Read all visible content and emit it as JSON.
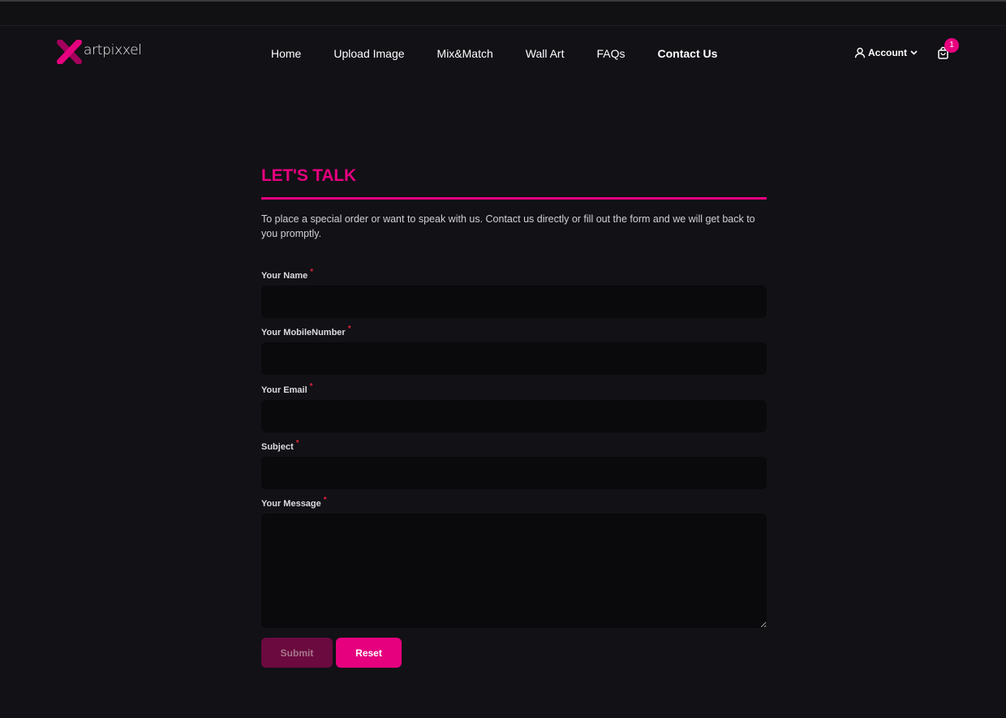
{
  "brand": {
    "name": "artpixxel",
    "accent": "#e6007e"
  },
  "nav": {
    "items": [
      {
        "label": "Home"
      },
      {
        "label": "Upload Image"
      },
      {
        "label": "Mix&Match"
      },
      {
        "label": "Wall Art"
      },
      {
        "label": "FAQs"
      },
      {
        "label": "Contact Us",
        "active": true
      }
    ]
  },
  "header": {
    "account_label": "Account",
    "account_icon": "user-icon",
    "cart_icon": "shopping-bag-icon",
    "cart_count": "1"
  },
  "contact": {
    "title": "LET'S TALK",
    "intro": "To place a special order or want to speak with us. Contact us directly or fill out the form and we will get back to you promptly.",
    "fields": [
      {
        "label": "Your Name",
        "required_mark": "*",
        "value": ""
      },
      {
        "label": "Your MobileNumber",
        "required_mark": "*",
        "value": ""
      },
      {
        "label": "Your Email",
        "required_mark": "*",
        "value": ""
      },
      {
        "label": "Subject",
        "required_mark": "*",
        "value": ""
      },
      {
        "label": "Your Message",
        "required_mark": "*",
        "value": ""
      }
    ],
    "submit_label": "Submit",
    "reset_label": "Reset"
  }
}
